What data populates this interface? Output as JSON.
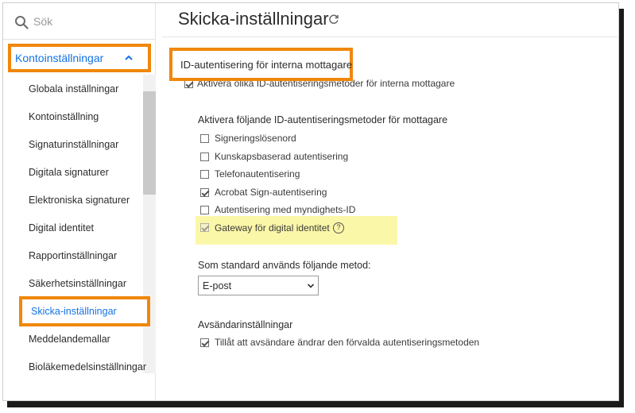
{
  "search": {
    "placeholder": "Sök",
    "icon": "search-icon"
  },
  "sidebar": {
    "group_label": "Kontoinställningar",
    "items": [
      "Globala inställningar",
      "Kontoinställning",
      "Signaturinställningar",
      "Digitala signaturer",
      "Elektroniska signaturer",
      "Digital identitet",
      "Rapportinställningar",
      "Säkerhetsinställningar",
      "Skicka-inställningar",
      "Meddelandemallar",
      "Bioläkemedelsinställningar"
    ],
    "active_item": "Skicka-inställningar"
  },
  "main": {
    "title": "Skicka-inställningar",
    "section_title": "ID-autentisering för interna mottagare",
    "enable_internal_label": "Aktivera olika ID-autentiseringsmetoder för interna mottagare",
    "enable_internal_checked": true,
    "methods_heading": "Aktivera följande ID-autentiseringsmetoder för mottagare",
    "methods": [
      {
        "label": "Signeringslösenord",
        "checked": false
      },
      {
        "label": "Kunskapsbaserad autentisering",
        "checked": false
      },
      {
        "label": "Telefonautentisering",
        "checked": false
      },
      {
        "label": "Acrobat Sign-autentisering",
        "checked": true
      },
      {
        "label": "Autentisering med myndighets-ID",
        "checked": false
      },
      {
        "label": "Gateway för digital identitet",
        "checked": true
      }
    ],
    "help_glyph": "?",
    "default_heading": "Som standard används följande metod:",
    "default_value": "E-post",
    "sender_heading": "Avsändarinställningar",
    "sender_option_label": "Tillåt att avsändare ändrar den förvalda autentiseringsmetoden",
    "sender_option_checked": true
  },
  "colors": {
    "accent_orange": "#f0870a",
    "link_blue": "#1473e6",
    "highlight_yellow": "#fbf7a8"
  }
}
